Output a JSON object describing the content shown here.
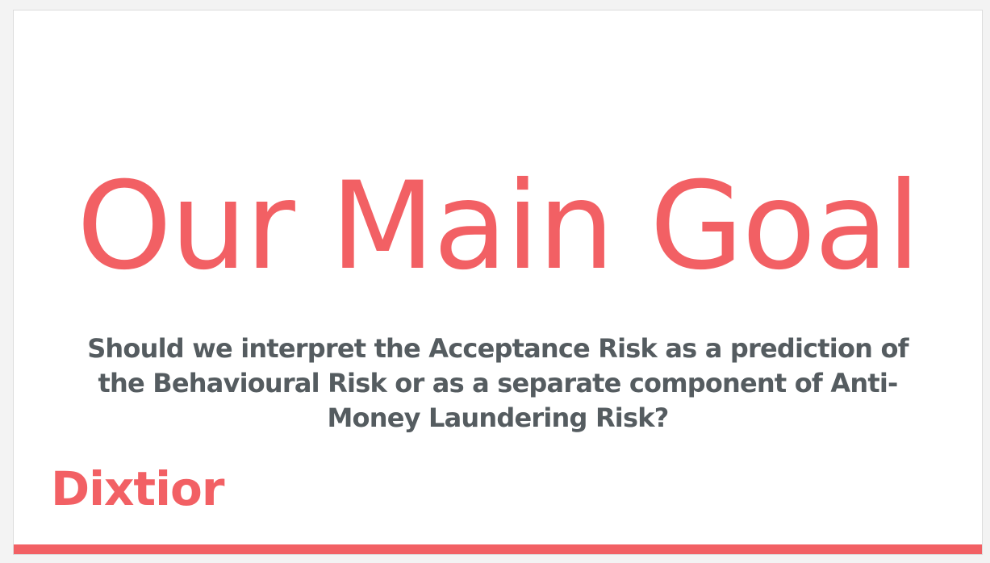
{
  "slide": {
    "title": "Our Main Goal",
    "subtitle": "Should we interpret the Acceptance Risk as a prediction of the Behavioural Risk or as a separate component of Anti-Money Laundering Risk?",
    "logo_text": "Dixtior"
  },
  "colors": {
    "accent": "#f26064",
    "subtitle_text": "#555c60",
    "background": "#ffffff"
  }
}
